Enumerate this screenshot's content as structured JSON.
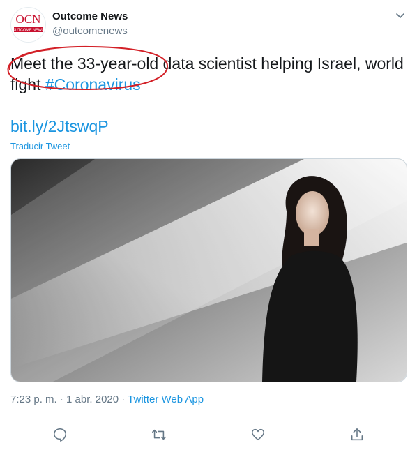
{
  "tweet": {
    "author_name": "Outcome News",
    "author_handle": "@outcomenews",
    "avatar_text_big": "OCN",
    "avatar_text_small": "OUTCOME NEWS",
    "text_line1": "Meet the 33-year-old data scientist helping Israel, world",
    "text_line2_prefix": "fight ",
    "hashtag": "#Coronavirus",
    "link": "bit.ly/2JtswqP",
    "translate_label": "Traducir Tweet",
    "timestamp": "7:23 p. m. · 1 abr. 2020",
    "separator": " · ",
    "source_app": "Twitter Web App"
  },
  "icons": {
    "more": "chevron-down-icon",
    "reply": "reply-icon",
    "retweet": "retweet-icon",
    "like": "heart-icon",
    "share": "share-icon"
  },
  "colors": {
    "link_blue": "#1b95e0",
    "muted_gray": "#657786",
    "annotation_red": "#d32027",
    "brand_red": "#c8102e"
  }
}
